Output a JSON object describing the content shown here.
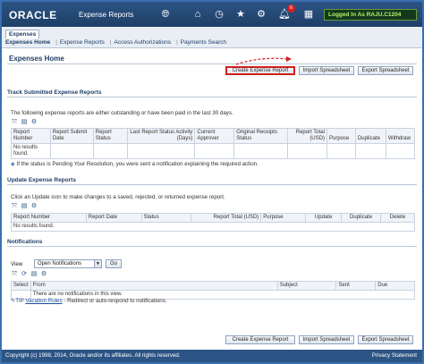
{
  "header": {
    "logo": "ORACLE",
    "app_title": "Expense Reports",
    "notification_count": "6",
    "user": "Logged In As RAJU.C1204",
    "icons": [
      "globe-icon",
      "home-icon",
      "clock-icon",
      "star-icon",
      "gear-icon",
      "bell-icon",
      "grid-icon"
    ]
  },
  "nav": {
    "tab": "Expenses",
    "items": [
      "Expenses Home",
      "Expense Reports",
      "Access Authorizations",
      "Payments Search"
    ]
  },
  "page": {
    "title": "Expenses Home",
    "buttons": {
      "create": "Create Expense Report",
      "import": "Import Spreadsheet",
      "export": "Export Spreadsheet"
    }
  },
  "track": {
    "heading": "Track Submitted Expense Reports",
    "description": "The following expense reports are either outstanding or have been paid in the last 30 days.",
    "columns": [
      "Report Number",
      "Report Submit Date",
      "Report Status",
      "Last Report Status Activity (Days)",
      "Current Approver",
      "Original Receipts Status",
      "Report Total (USD)",
      "Purpose",
      "Duplicate",
      "Withdraw"
    ],
    "empty": "No results found.",
    "note": "If the status is Pending Your Resolution, you were sent a notification explaining the required action."
  },
  "update": {
    "heading": "Update Expense Reports",
    "description": "Click an Update icon to make changes to a saved, rejected, or returned expense report.",
    "columns": [
      "Report Number",
      "Report Date",
      "Status",
      "Report Total (USD)",
      "Purpose",
      "Update",
      "Duplicate",
      "Delete"
    ],
    "empty": "No results found."
  },
  "notifications": {
    "heading": "Notifications",
    "view_label": "View",
    "view_value": "Open Notifications",
    "go": "Go",
    "columns": [
      "Select",
      "From",
      "Subject",
      "Sent",
      "Due"
    ],
    "empty": "There are no notifications in this view.",
    "tip_label": "TIP",
    "tip_link": "Vacation Rules",
    "tip_text": " - Redirect or auto-respond to notifications."
  },
  "footer": {
    "copyright": "Copyright (c) 1998, 2014, Oracle and/or its affiliates. All rights reserved.",
    "privacy": "Privacy Statement"
  },
  "colors": {
    "header_blue": "#2c5485",
    "highlight_red": "#d21e1e",
    "user_green": "#b6f06a"
  }
}
